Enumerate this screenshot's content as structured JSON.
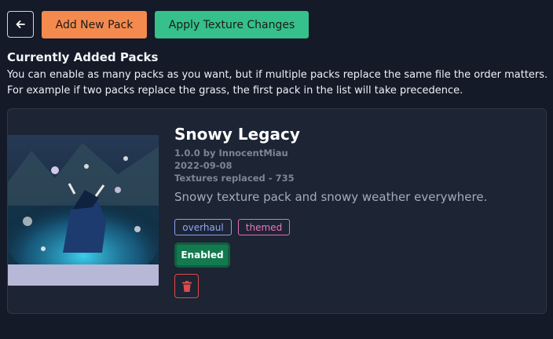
{
  "toolbar": {
    "back_icon": "arrow-left-icon",
    "add_label": "Add New Pack",
    "apply_label": "Apply Texture Changes",
    "colors": {
      "add": "#f58a4e",
      "apply": "#35c08c"
    }
  },
  "section": {
    "title": "Currently Added Packs",
    "line1": "You can enable as many packs as you want, but if multiple packs replace the same file the order matters.",
    "line2": "For example if two packs replace the grass, the first pack in the list will take precedence."
  },
  "pack": {
    "name": "Snowy Legacy",
    "version_author": "1.0.0 by InnocentMiau",
    "date": "2022-09-08",
    "textures_replaced": "Textures replaced - 735",
    "description": "Snowy texture pack and snowy weather everywhere.",
    "tags": [
      "overhaul",
      "themed"
    ],
    "status_label": "Enabled",
    "status_color": "#137a4f",
    "delete_icon": "trash-icon",
    "thumbnail_icon": "pack-thumbnail-image"
  }
}
